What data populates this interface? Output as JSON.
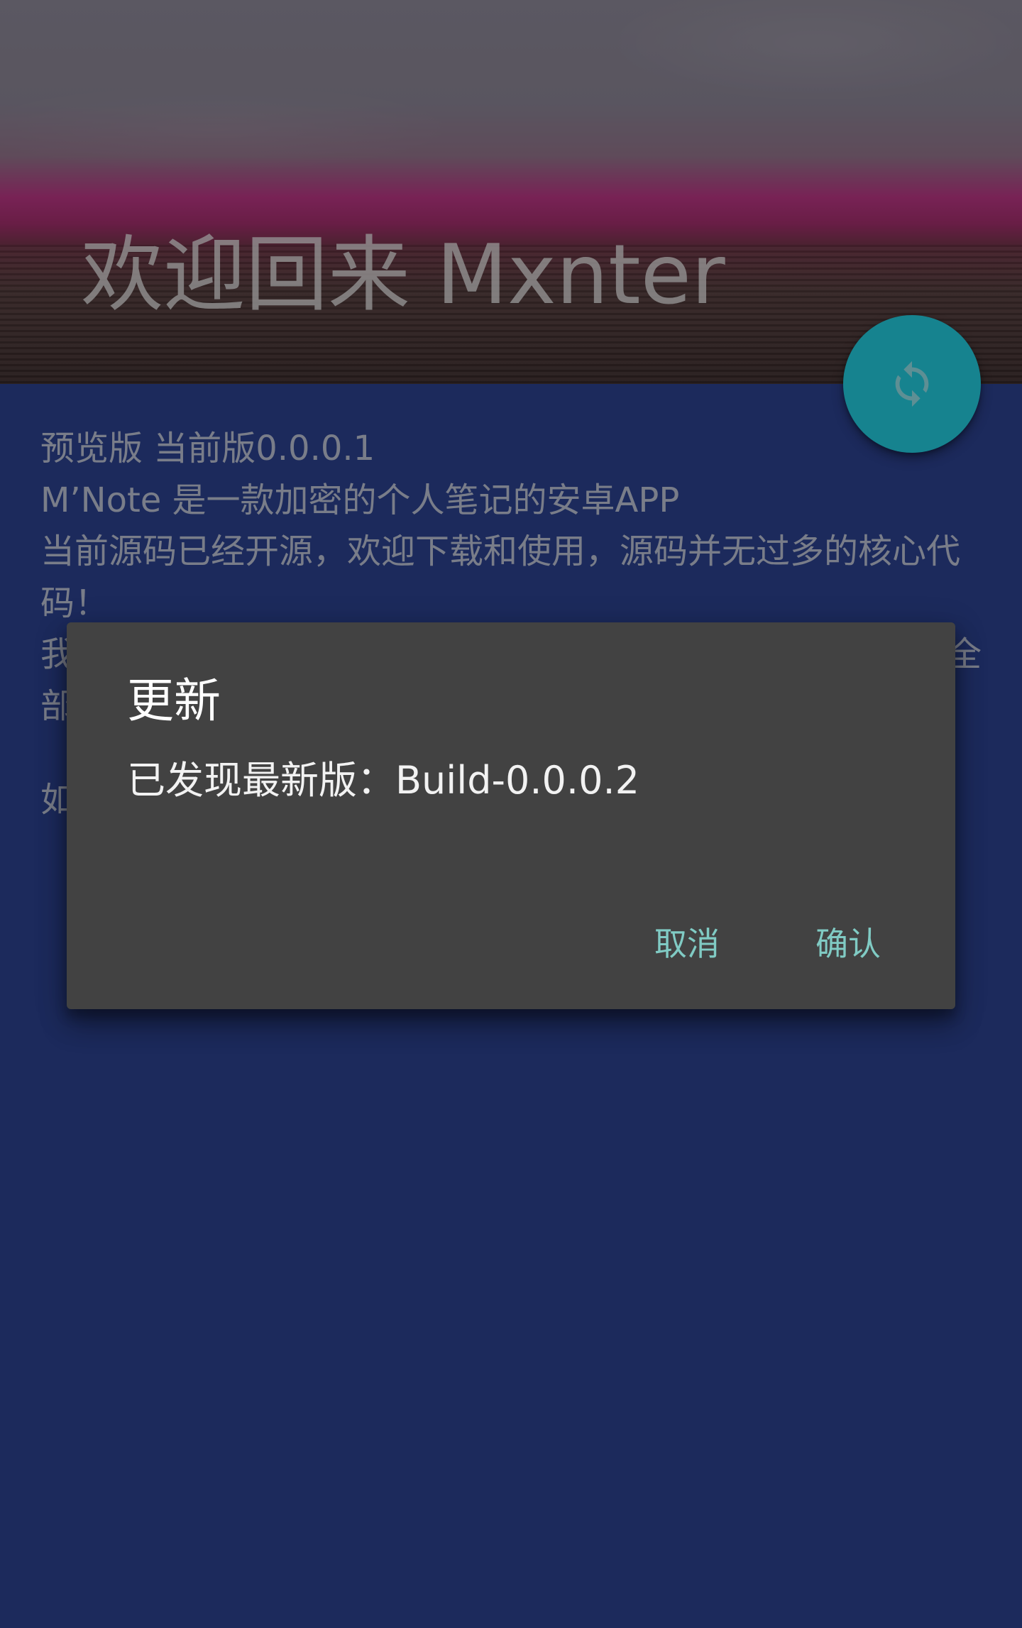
{
  "header": {
    "title": "欢迎回来 Mxnter"
  },
  "fab": {
    "icon": "refresh-icon"
  },
  "content": {
    "lines": [
      "预览版 当前版0.0.0.1",
      "M’Note 是一款加密的个人笔记的安卓APP",
      "当前源码已经开源，欢迎下载和使用，源码并无过多的核心代",
      "码！"
    ],
    "partial_lines": [
      {
        "start": "我",
        "end": "全"
      },
      {
        "start": "部"
      },
      {
        "start": "如"
      }
    ]
  },
  "dialog": {
    "title": "更新",
    "message": "已发现最新版：Build-0.0.0.2",
    "cancel_label": "取消",
    "confirm_label": "确认"
  },
  "colors": {
    "page_background": "#2f4699",
    "fab_accent": "#26daee",
    "dialog_background": "#424242",
    "dialog_button_text": "#80cbc4",
    "scrim": "rgba(0,0,0,0.4)"
  }
}
